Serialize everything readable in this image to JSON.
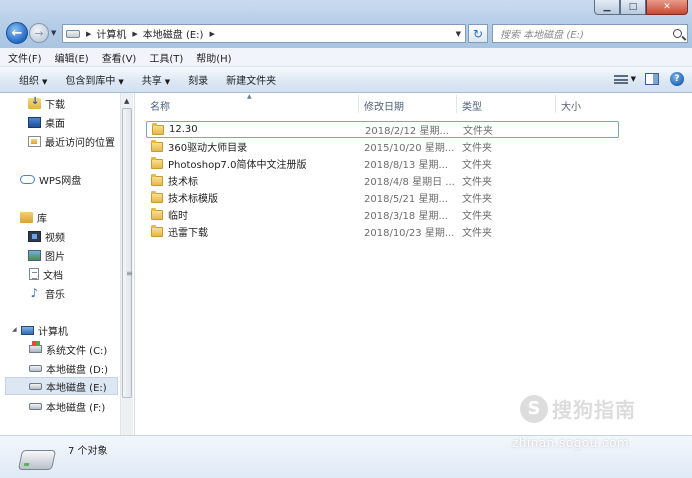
{
  "window": {
    "minimize_icon": "minimize-icon",
    "maximize_icon": "maximize-icon",
    "close_icon": "close-icon"
  },
  "address": {
    "crumbs": [
      "计算机",
      "本地磁盘 (E:)"
    ]
  },
  "search": {
    "placeholder": "搜索 本地磁盘 (E:)"
  },
  "menu": [
    "文件(F)",
    "编辑(E)",
    "查看(V)",
    "工具(T)",
    "帮助(H)"
  ],
  "commands": {
    "organize": "组织",
    "include_library": "包含到库中",
    "share": "共享",
    "burn": "刻录",
    "new_folder": "新建文件夹"
  },
  "nav": {
    "favorites": [
      "下载",
      "桌面",
      "最近访问的位置"
    ],
    "wps": "WPS网盘",
    "library": "库",
    "library_items": [
      "视频",
      "图片",
      "文档",
      "音乐"
    ],
    "computer": "计算机",
    "drives": [
      "系统文件 (C:)",
      "本地磁盘 (D:)",
      "本地磁盘 (E:)",
      "本地磁盘 (F:)"
    ],
    "selected_drive": "本地磁盘 (E:)"
  },
  "columns": {
    "name": "名称",
    "date": "修改日期",
    "type": "类型",
    "size": "大小"
  },
  "files": [
    {
      "name": "12.30",
      "date": "2018/2/12 星期...",
      "type": "文件夹"
    },
    {
      "name": "360驱动大师目录",
      "date": "2015/10/20 星期...",
      "type": "文件夹"
    },
    {
      "name": "Photoshop7.0简体中文注册版",
      "date": "2018/8/13 星期...",
      "type": "文件夹"
    },
    {
      "name": "技术标",
      "date": "2018/4/8 星期日 ...",
      "type": "文件夹"
    },
    {
      "name": "技术标模版",
      "date": "2018/5/21 星期...",
      "type": "文件夹"
    },
    {
      "name": "临时",
      "date": "2018/3/18 星期...",
      "type": "文件夹"
    },
    {
      "name": "迅雷下载",
      "date": "2018/10/23 星期...",
      "type": "文件夹"
    }
  ],
  "status": {
    "count": "7 个对象"
  },
  "watermark": {
    "logo": "S",
    "text": "搜狗指南",
    "url": "zhinan.sogou.com"
  }
}
